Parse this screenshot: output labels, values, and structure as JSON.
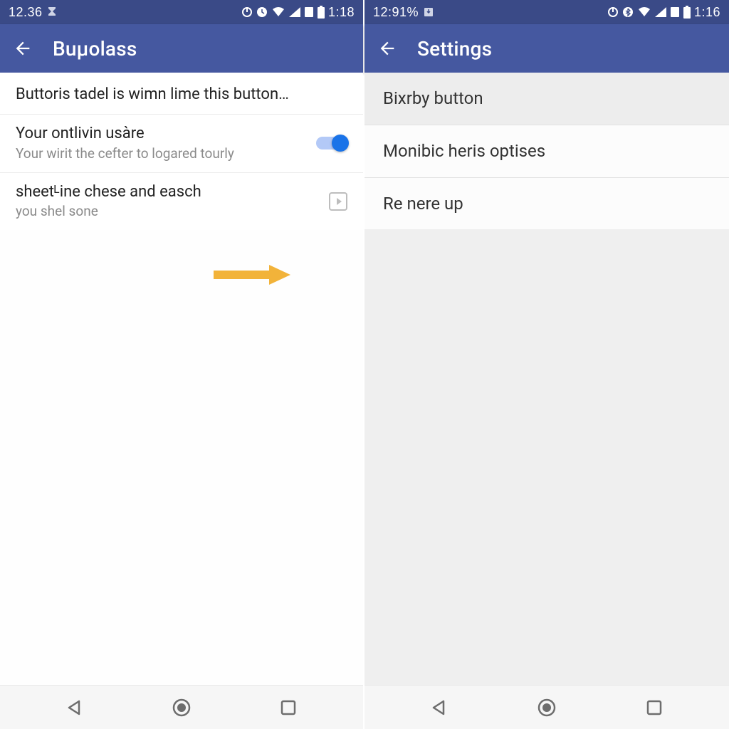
{
  "left": {
    "status": {
      "time": "12.36",
      "clock": "1:18"
    },
    "appbar": {
      "title": "Buμolass"
    },
    "items": [
      {
        "title": "Buttoris tadel is wimn lime this button…"
      },
      {
        "title": "Your ontlivin usàre",
        "sub": "Your wirit the cefter to logared tourly"
      },
      {
        "title": "sheetᴸine chese and easch",
        "sub": "you shel sone"
      }
    ]
  },
  "right": {
    "status": {
      "time": "12:91%",
      "clock": "1:16"
    },
    "appbar": {
      "title": "Settings"
    },
    "items": [
      {
        "title": "Bixrby button"
      },
      {
        "title": "Monibic heris optises"
      },
      {
        "title": "Re nere up"
      }
    ]
  }
}
